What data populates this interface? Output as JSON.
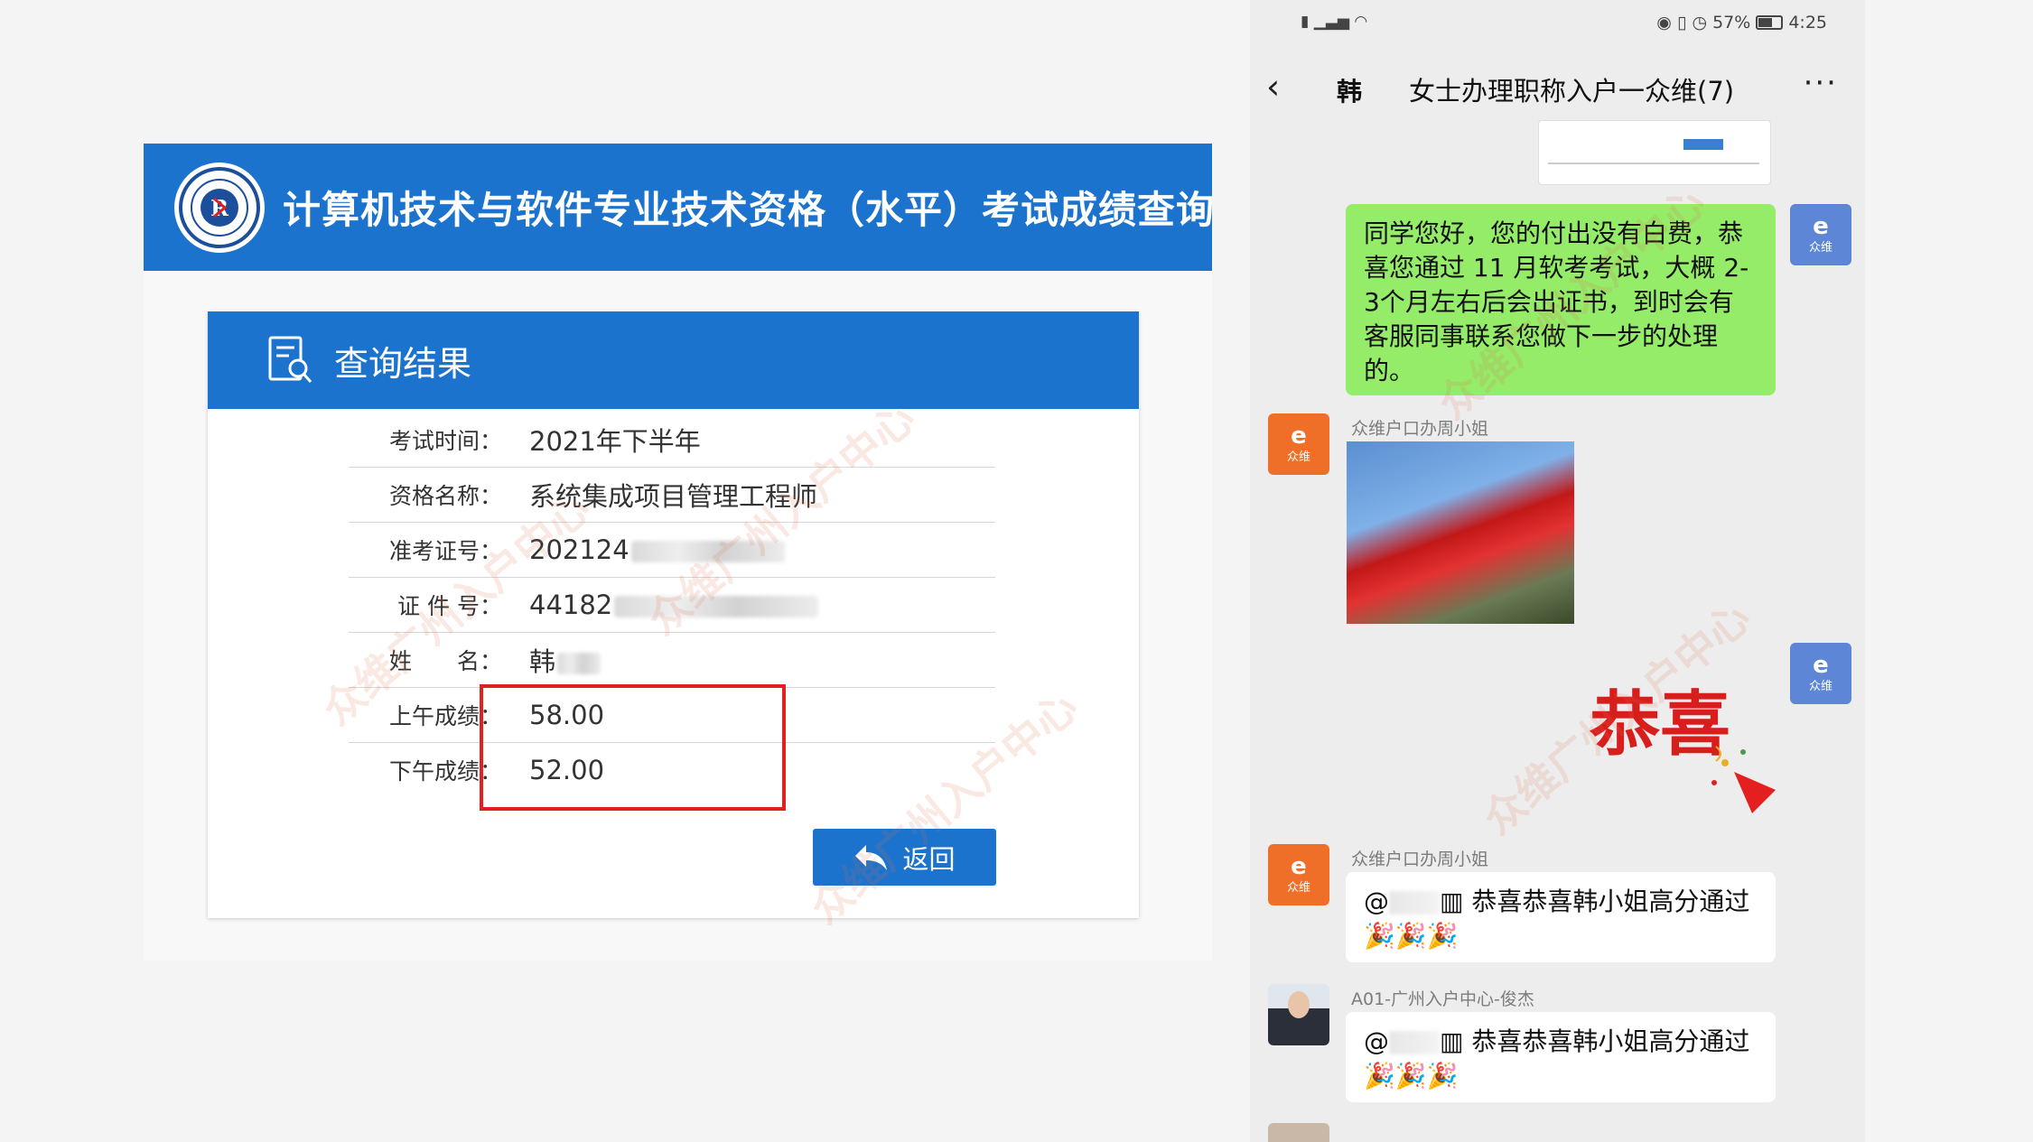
{
  "score_query": {
    "banner_title": "计算机技术与软件专业技术资格（水平）考试成绩查询",
    "result_title": "查询结果",
    "rows": [
      {
        "label": "考试时间：",
        "value": "2021年下半年"
      },
      {
        "label": "资格名称：",
        "value": "系统集成项目管理工程师"
      },
      {
        "label": "准考证号：",
        "value": "202124"
      },
      {
        "label": "证 件 号：",
        "value": "44182"
      },
      {
        "label": "姓　　名：",
        "value": "韩"
      },
      {
        "label": "上午成绩：",
        "value": "58.00"
      },
      {
        "label": "下午成绩：",
        "value": "52.00"
      }
    ],
    "back_label": "返回"
  },
  "watermark": "众维广州入户中心",
  "phone": {
    "status": {
      "battery": "57%",
      "time": "4:25"
    },
    "header": {
      "name_prefix": "韩",
      "title": "女士办理职称入户一众维(7)"
    },
    "messages": {
      "outgoing_text": "同学您好，您的付出没有白费，恭喜您通过 11 月软考考试，大概 2-3个月左右后会出证书，到时会有客服同事联系您做下一步的处理的。",
      "sender1": "众维户口办周小姐",
      "sticker_text": "恭喜",
      "sender2": "众维户口办周小姐",
      "congrats2": "恭喜恭喜韩小姐高分通过",
      "sender3": "A01-广州入户中心-俊杰",
      "congrats3": "恭喜恭喜韩小姐高分通过",
      "mention": "@",
      "logo_text": "众维"
    }
  },
  "colors": {
    "banner": "#1b73cd",
    "highlight": "#e31f1f",
    "bubble_green": "#95ec69",
    "brand_orange": "#f06f28"
  }
}
